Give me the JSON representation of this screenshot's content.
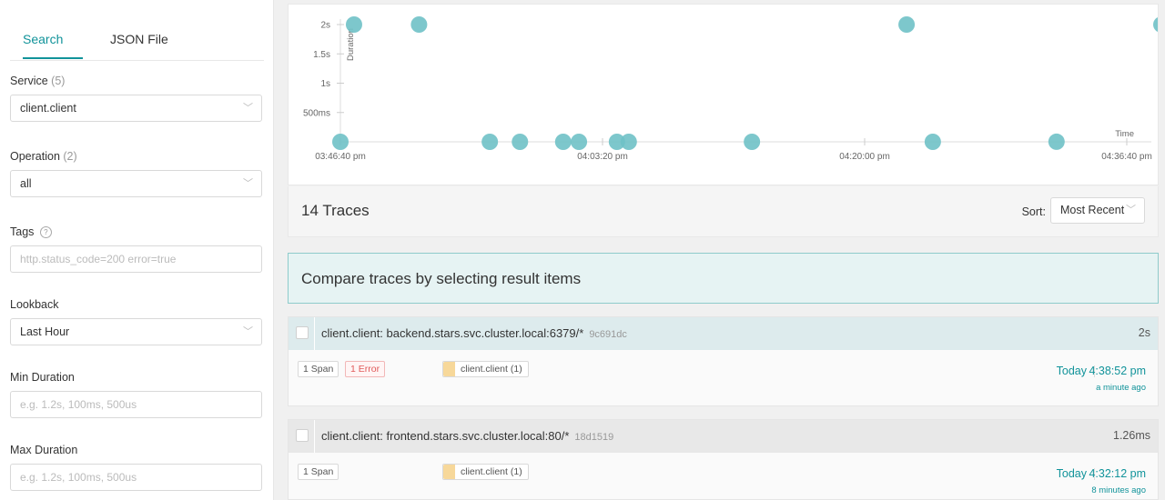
{
  "sidebar": {
    "tabs": [
      {
        "label": "Search",
        "active": true
      },
      {
        "label": "JSON File",
        "active": false
      }
    ],
    "service": {
      "label": "Service",
      "count": "(5)",
      "value": "client.client"
    },
    "operation": {
      "label": "Operation",
      "count": "(2)",
      "value": "all"
    },
    "tags": {
      "label": "Tags",
      "help_icon": "?",
      "placeholder": "http.status_code=200 error=true"
    },
    "lookback": {
      "label": "Lookback",
      "value": "Last Hour"
    },
    "min_duration": {
      "label": "Min Duration",
      "placeholder": "e.g. 1.2s, 100ms, 500us"
    },
    "max_duration": {
      "label": "Max Duration",
      "placeholder": "e.g. 1.2s, 100ms, 500us"
    }
  },
  "chart_data": {
    "type": "scatter",
    "title": "",
    "ylabel": "Duration",
    "xlabel": "Time",
    "y_tick_labels": [
      "2s",
      "1.5s",
      "1s",
      "500ms"
    ],
    "y_tick_values_ms": [
      2000,
      1500,
      1000,
      500
    ],
    "ylim_ms": [
      0,
      2000
    ],
    "x_tick_labels": [
      "03:46:40 pm",
      "04:03:20 pm",
      "04:20:00 pm",
      "04:36:40 pm"
    ],
    "xlim": [
      "03:46:40 pm",
      "04:36:40 pm"
    ],
    "grid": false,
    "color": "#6fc1c7",
    "points": [
      {
        "x": "03:47:32 pm",
        "y_ms": 2000
      },
      {
        "x": "03:51:40 pm",
        "y_ms": 2000
      },
      {
        "x": "04:22:40 pm",
        "y_ms": 2000
      },
      {
        "x": "04:38:52 pm",
        "y_ms": 2000
      },
      {
        "x": "03:46:40 pm",
        "y_ms": 0
      },
      {
        "x": "03:56:10 pm",
        "y_ms": 0
      },
      {
        "x": "03:58:05 pm",
        "y_ms": 0
      },
      {
        "x": "04:00:50 pm",
        "y_ms": 0
      },
      {
        "x": "04:01:50 pm",
        "y_ms": 0
      },
      {
        "x": "04:04:15 pm",
        "y_ms": 0
      },
      {
        "x": "04:05:00 pm",
        "y_ms": 0
      },
      {
        "x": "04:12:50 pm",
        "y_ms": 0
      },
      {
        "x": "04:24:20 pm",
        "y_ms": 0
      },
      {
        "x": "04:32:12 pm",
        "y_ms": 1.26
      }
    ]
  },
  "results": {
    "count_label": "14 Traces",
    "sort_label": "Sort:",
    "sort_value": "Most Recent"
  },
  "compare_banner": "Compare traces by selecting result items",
  "traces": [
    {
      "title": "client.client: backend.stars.svc.cluster.local:6379/*",
      "trace_id": "9c691dc",
      "duration": "2s",
      "spans": "1 Span",
      "errors": "1 Error",
      "service_tag": "client.client (1)",
      "date": "Today",
      "time": "4:38:52 pm",
      "ago": "a minute ago"
    },
    {
      "title": "client.client: frontend.stars.svc.cluster.local:80/*",
      "trace_id": "18d1519",
      "duration": "1.26ms",
      "spans": "1 Span",
      "service_tag": "client.client (1)",
      "date": "Today",
      "time": "4:32:12 pm",
      "ago": "8 minutes ago"
    }
  ],
  "icons": {
    "dropdown": "chevron-down-icon",
    "help": "question-circle-icon",
    "checkbox": "checkbox-icon"
  },
  "colors": {
    "accent": "#11939a",
    "scatter_point": "#6fc1c7",
    "error": "#e05a5a",
    "service_color": "#f7d89a",
    "compare_bg": "#e6f3f3"
  }
}
